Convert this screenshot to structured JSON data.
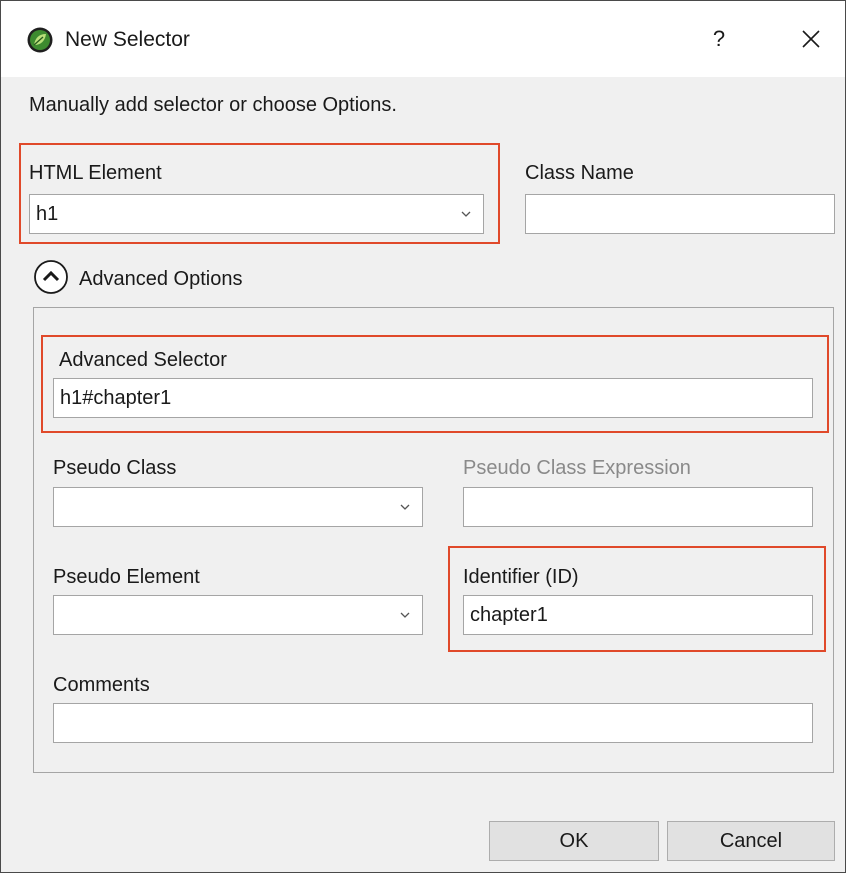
{
  "window": {
    "title": "New Selector",
    "help_label": "?"
  },
  "intro_text": "Manually add selector or choose Options.",
  "html_element": {
    "label": "HTML Element",
    "value": "h1"
  },
  "class_name": {
    "label": "Class Name",
    "value": ""
  },
  "advanced": {
    "toggle_label": "Advanced Options",
    "selector_label": "Advanced Selector",
    "selector_value": "h1#chapter1",
    "pseudo_class_label": "Pseudo Class",
    "pseudo_class_value": "",
    "pseudo_class_expression_label": "Pseudo Class Expression",
    "pseudo_class_expression_value": "",
    "pseudo_element_label": "Pseudo Element",
    "pseudo_element_value": "",
    "identifier_label": "Identifier (ID)",
    "identifier_value": "chapter1",
    "comments_label": "Comments",
    "comments_value": ""
  },
  "buttons": {
    "ok": "OK",
    "cancel": "Cancel"
  },
  "colors": {
    "highlight": "#e0492a",
    "app_icon": "#3d8b2f"
  },
  "icons": [
    "app-leaf-icon",
    "close-icon",
    "chevron-down-icon",
    "collapse-up-icon"
  ]
}
